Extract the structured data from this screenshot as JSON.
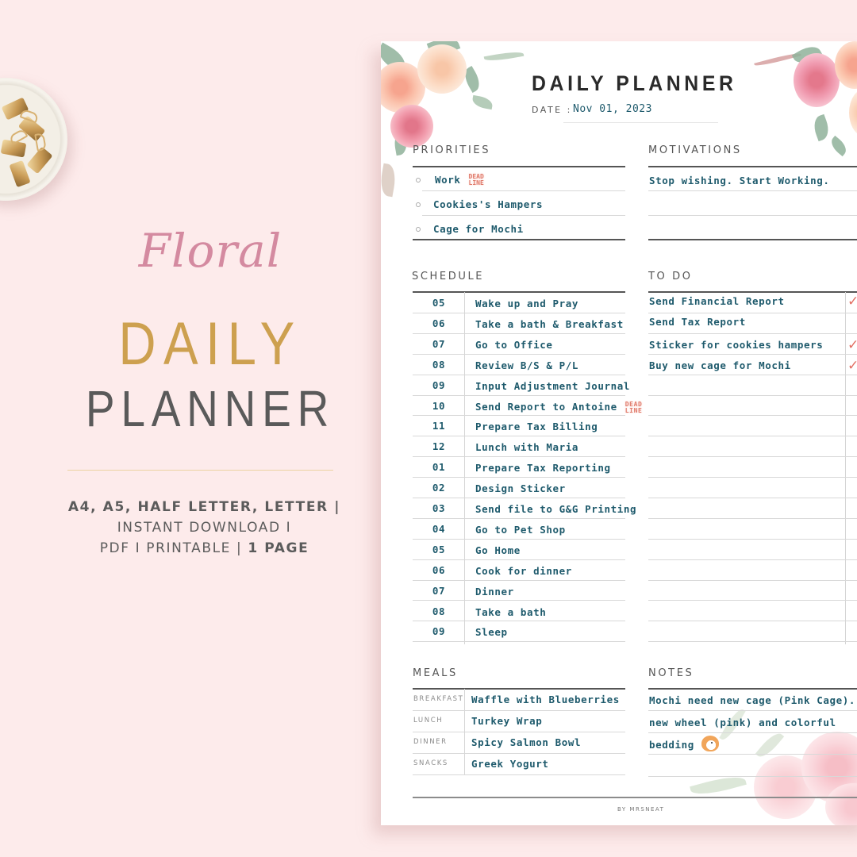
{
  "promo": {
    "script_title": "Floral",
    "title_line1": "DAILY",
    "title_line2": "PLANNER",
    "formats_line1": "A4, A5, HALF LETTER, LETTER |",
    "formats_line2": "INSTANT DOWNLOAD I",
    "formats_line3_a": "PDF I PRINTABLE | ",
    "formats_line3_b": "1 PAGE",
    "colors": {
      "background": "#fdebeb",
      "script": "#d48aa0",
      "gold": "#cda04f",
      "gray": "#5a5a5a"
    }
  },
  "planner": {
    "title": "DAILY PLANNER",
    "date_label": "DATE :",
    "date_value": "Nov 01, 2023",
    "priorities": {
      "heading": "PRIORITIES",
      "items": [
        {
          "text": "Work",
          "sticker": "DEAD LINE"
        },
        {
          "text": "Cookies's Hampers"
        },
        {
          "text": "Cage for Mochi"
        }
      ]
    },
    "motivations": {
      "heading": "MOTIVATIONS",
      "lines": [
        "Stop wishing. Start Working.",
        "",
        ""
      ]
    },
    "schedule": {
      "heading": "SCHEDULE",
      "rows": [
        {
          "hour": "05",
          "task": "Wake up and Pray"
        },
        {
          "hour": "06",
          "task": "Take a bath & Breakfast"
        },
        {
          "hour": "07",
          "task": "Go to Office"
        },
        {
          "hour": "08",
          "task": "Review B/S & P/L"
        },
        {
          "hour": "09",
          "task": "Input Adjustment Journal"
        },
        {
          "hour": "10",
          "task": "Send Report to Antoine",
          "sticker": "DEAD LINE"
        },
        {
          "hour": "11",
          "task": "Prepare Tax Billing"
        },
        {
          "hour": "12",
          "task": "Lunch with Maria"
        },
        {
          "hour": "01",
          "task": "Prepare Tax Reporting"
        },
        {
          "hour": "02",
          "task": "Design Sticker"
        },
        {
          "hour": "03",
          "task": "Send file to G&G Printing"
        },
        {
          "hour": "04",
          "task": "Go to Pet Shop"
        },
        {
          "hour": "05",
          "task": "Go Home"
        },
        {
          "hour": "06",
          "task": "Cook for dinner"
        },
        {
          "hour": "07",
          "task": "Dinner"
        },
        {
          "hour": "08",
          "task": "Take a bath"
        },
        {
          "hour": "09",
          "task": "Sleep"
        }
      ]
    },
    "todo": {
      "heading": "TO DO",
      "check_glyph": "✓",
      "items": [
        {
          "text": "Send Financial Report",
          "done": true
        },
        {
          "text": "Send Tax Report",
          "done": false
        },
        {
          "text": "Sticker for cookies hampers",
          "done": true
        },
        {
          "text": "Buy new cage for Mochi",
          "done": true
        }
      ],
      "empty_rows": 13
    },
    "meals": {
      "heading": "MEALS",
      "rows": [
        {
          "label": "BREAKFAST",
          "value": "Waffle with Blueberries"
        },
        {
          "label": "LUNCH",
          "value": "Turkey Wrap"
        },
        {
          "label": "DINNER",
          "value": "Spicy Salmon Bowl"
        },
        {
          "label": "SNACKS",
          "value": "Greek Yogurt"
        }
      ]
    },
    "notes": {
      "heading": "NOTES",
      "lines": [
        "Mochi need new cage (Pink Cage).",
        "new wheel (pink) and colorful",
        "bedding"
      ]
    },
    "footer": "BY MRSNEAT",
    "colors": {
      "ink": "#1e5a6c",
      "check": "#e26e62",
      "rule": "#555555",
      "sticker": "#e07d6e"
    }
  }
}
